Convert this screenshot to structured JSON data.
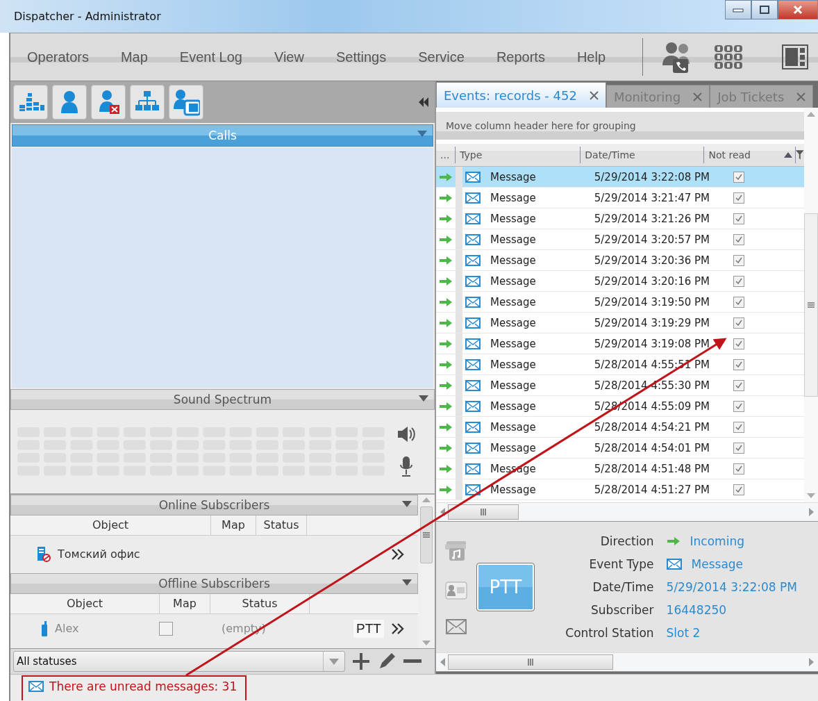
{
  "window": {
    "title": "Dispatcher - Administrator"
  },
  "menu": [
    "Operators",
    "Map",
    "Event Log",
    "View",
    "Settings",
    "Service",
    "Reports",
    "Help"
  ],
  "left_panel": {
    "calls": {
      "title": "Calls"
    },
    "sound_spectrum": {
      "title": "Sound Spectrum"
    },
    "online_subscribers": {
      "title": "Online Subscribers",
      "columns": [
        "Object",
        "Map",
        "Status"
      ],
      "rows": [
        {
          "object": "Томский офис"
        }
      ]
    },
    "offline_subscribers": {
      "title": "Offline Subscribers",
      "columns": [
        "Object",
        "Map",
        "Status"
      ],
      "rows": [
        {
          "object": "Alex",
          "map_checked": false,
          "status": "(empty)",
          "button": "PTT"
        }
      ]
    },
    "status_filter": {
      "value": "All statuses"
    }
  },
  "tabs": [
    {
      "label": "Events: records - 452",
      "selected": true
    },
    {
      "label": "Monitoring",
      "selected": false
    },
    {
      "label": "Job Tickets",
      "selected": false
    }
  ],
  "events": {
    "grouping_hint": "Move column header here for grouping",
    "columns": [
      "...",
      "Type",
      "Date/Time",
      "Not read"
    ],
    "rows": [
      {
        "type": "Message",
        "datetime": "5/29/2014 3:22:08 PM",
        "not_read": true,
        "selected": true
      },
      {
        "type": "Message",
        "datetime": "5/29/2014 3:21:47 PM",
        "not_read": true,
        "selected": false
      },
      {
        "type": "Message",
        "datetime": "5/29/2014 3:21:26 PM",
        "not_read": true,
        "selected": false
      },
      {
        "type": "Message",
        "datetime": "5/29/2014 3:20:57 PM",
        "not_read": true,
        "selected": false
      },
      {
        "type": "Message",
        "datetime": "5/29/2014 3:20:36 PM",
        "not_read": true,
        "selected": false
      },
      {
        "type": "Message",
        "datetime": "5/29/2014 3:20:16 PM",
        "not_read": true,
        "selected": false
      },
      {
        "type": "Message",
        "datetime": "5/29/2014 3:19:50 PM",
        "not_read": true,
        "selected": false
      },
      {
        "type": "Message",
        "datetime": "5/29/2014 3:19:29 PM",
        "not_read": true,
        "selected": false
      },
      {
        "type": "Message",
        "datetime": "5/29/2014 3:19:08 PM",
        "not_read": true,
        "selected": false
      },
      {
        "type": "Message",
        "datetime": "5/28/2014 4:55:51 PM",
        "not_read": true,
        "selected": false
      },
      {
        "type": "Message",
        "datetime": "5/28/2014 4:55:30 PM",
        "not_read": true,
        "selected": false
      },
      {
        "type": "Message",
        "datetime": "5/28/2014 4:55:09 PM",
        "not_read": true,
        "selected": false
      },
      {
        "type": "Message",
        "datetime": "5/28/2014 4:54:21 PM",
        "not_read": true,
        "selected": false
      },
      {
        "type": "Message",
        "datetime": "5/28/2014 4:54:01 PM",
        "not_read": true,
        "selected": false
      },
      {
        "type": "Message",
        "datetime": "5/28/2014 4:51:48 PM",
        "not_read": true,
        "selected": false
      },
      {
        "type": "Message",
        "datetime": "5/28/2014 4:51:27 PM",
        "not_read": true,
        "selected": false
      }
    ]
  },
  "details": {
    "button": "PTT",
    "fields": [
      {
        "label": "Direction",
        "value": "Incoming",
        "kind": "direction"
      },
      {
        "label": "Event Type",
        "value": "Message",
        "kind": "message"
      },
      {
        "label": "Date/Time",
        "value": "5/29/2014 3:22:08 PM",
        "kind": "plain"
      },
      {
        "label": "Subscriber",
        "value": "16448250",
        "kind": "plain"
      },
      {
        "label": "Control Station",
        "value": "Slot 2",
        "kind": "plain"
      }
    ]
  },
  "status_bar": {
    "message": "There are unread messages: 31"
  },
  "annotation": {
    "kind": "arrow"
  }
}
